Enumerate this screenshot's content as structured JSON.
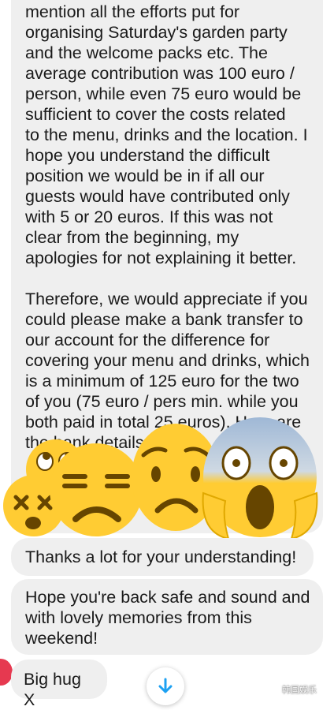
{
  "messages": [
    {
      "para1": "mention all the efforts put for\norganising Saturday's garden party\nand the welcome packs etc. The\naverage contribution was 100 euro /\nperson, while even 75 euro would be\nsufficient to cover the costs related\nto the menu, drinks and the location. I\nhope you understand the difficult\nposition we would be in if all our\nguests would have contributed only\nwith 5 or 20 euros. If this was not\nclear from the beginning, my\napologies for not explaining it better.",
      "para2": "Therefore, we would appreciate if you\ncould please make a bank transfer to\nour account for the difference for\ncovering your menu and drinks, which\nis a minimum of 125 euro for the two\nof you (75 euro / pers min. while you\nboth paid in total 25 euros). Here are\nthe bank details:"
    },
    {
      "text": "Thanks a lot for your understanding!"
    },
    {
      "text": "Hope you're back safe and sound and\nwith lovely memories from this\nweekend!"
    },
    {
      "text": "Big hug X"
    }
  ],
  "stickers": [
    "eye-roll-emoji",
    "dizzy-face-emoji",
    "unamused-face-emoji",
    "worried-face-emoji",
    "screaming-face-emoji"
  ],
  "scroll_icon": "arrow-down-icon",
  "watermark": {
    "text": "韩国娱乐"
  },
  "colors": {
    "bubble": "#efefef",
    "text": "#1a1a1a",
    "emoji": "#ffcc33",
    "accent_blue": "#1da1f2",
    "avatar": "#e63950"
  }
}
